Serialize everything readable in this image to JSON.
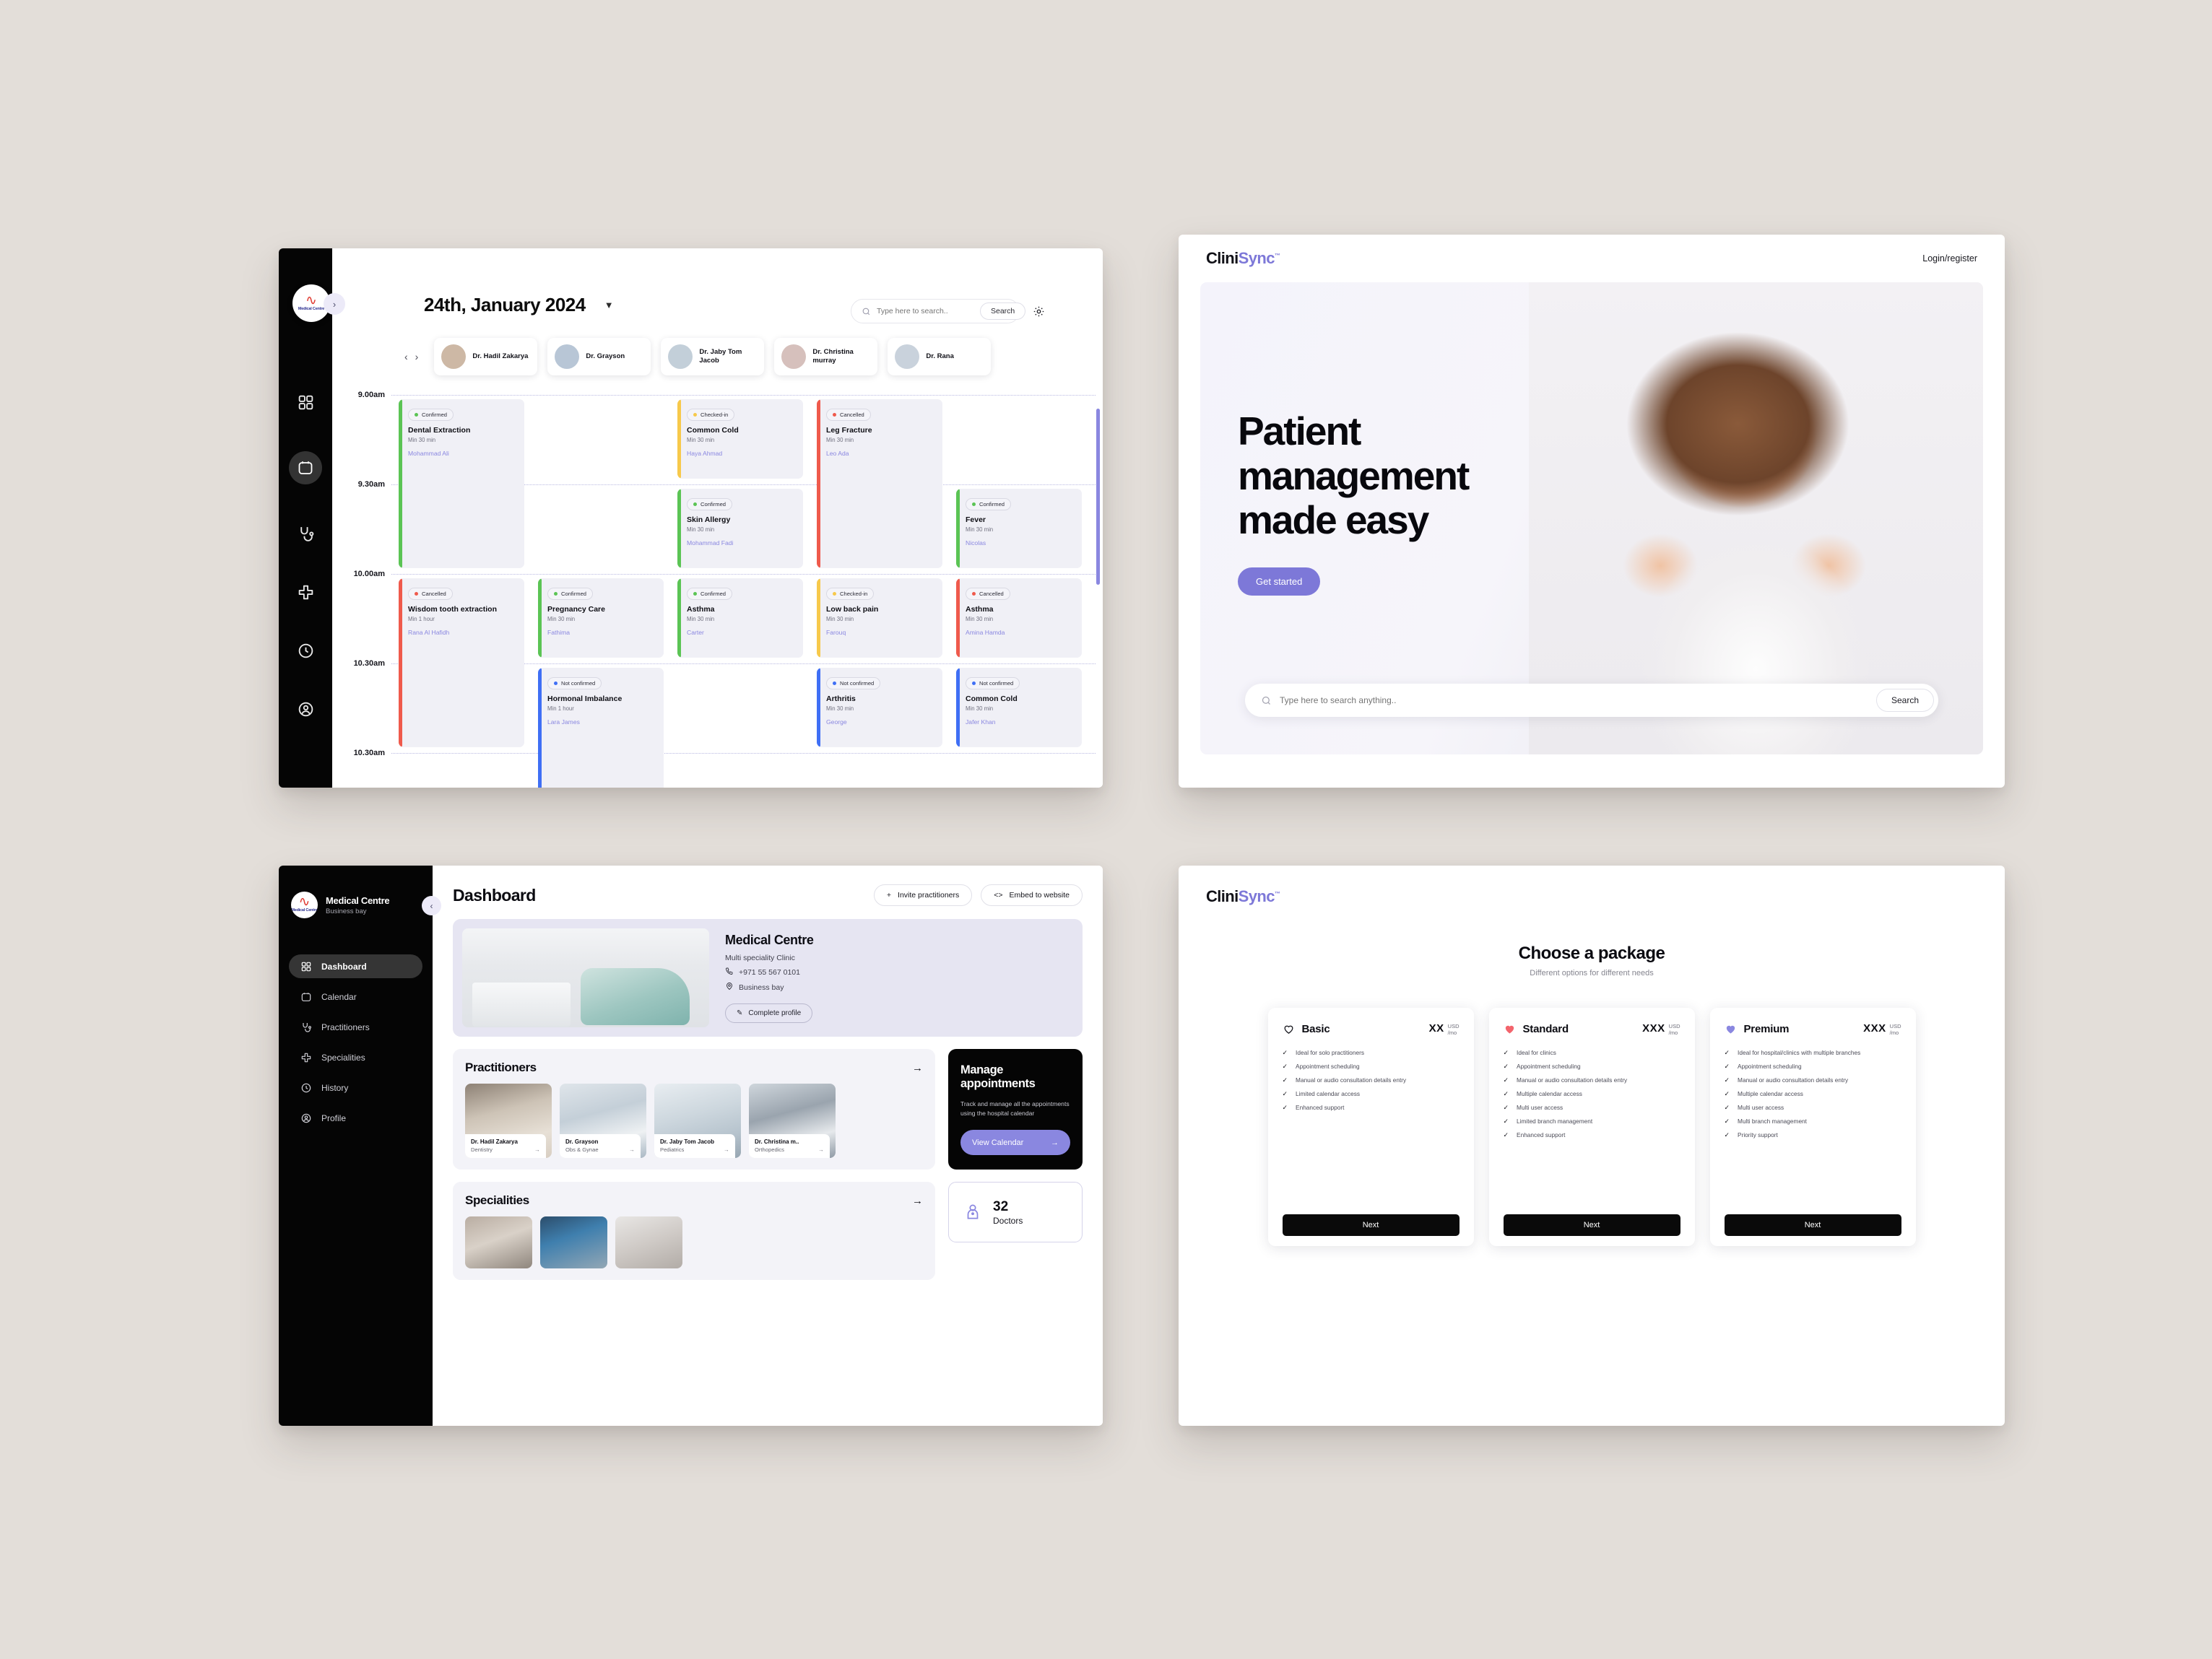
{
  "calendar": {
    "date_label": "24th, January 2024",
    "chevron_icon": "chevron-down-icon",
    "collapse_icon": "chevron-right-icon",
    "logo_text": "Medical Centre",
    "search": {
      "placeholder": "Type here to search..",
      "button_label": "Search"
    },
    "rail_items": [
      "dashboard-icon",
      "calendar-icon",
      "stethoscope-icon",
      "specialities-icon",
      "history-icon",
      "profile-icon"
    ],
    "doctors": [
      {
        "name": "Dr. Hadil Zakarya"
      },
      {
        "name": "Dr. Grayson"
      },
      {
        "name": "Dr. Jaby Tom Jacob"
      },
      {
        "name": "Dr. Christina murray"
      },
      {
        "name": "Dr. Rana"
      }
    ],
    "times": [
      "9.00am",
      "9.30am",
      "10.00am",
      "10.30am",
      "10.30am"
    ],
    "appointments": [
      {
        "status": "Confirmed",
        "color": "#5bc454",
        "title": "Dental Extraction",
        "duration": "Min 30 min",
        "patient": "Mohammad Ali",
        "col": 0,
        "row": 0,
        "span": 2
      },
      {
        "status": "Checked-in",
        "color": "#f7c94b",
        "title": "Common Cold",
        "duration": "Min 30 min",
        "patient": "Haya Ahmad",
        "col": 2,
        "row": 0,
        "span": 1
      },
      {
        "status": "Cancelled",
        "color": "#ef5a4c",
        "title": "Leg Fracture",
        "duration": "Min 30 min",
        "patient": "Leo Ada",
        "col": 3,
        "row": 0,
        "span": 2
      },
      {
        "status": "Confirmed",
        "color": "#5bc454",
        "title": "Skin Allergy",
        "duration": "Min 30 min",
        "patient": "Mohammad Fadi",
        "col": 2,
        "row": 1,
        "span": 1
      },
      {
        "status": "Confirmed",
        "color": "#5bc454",
        "title": "Fever",
        "duration": "Min 30 min",
        "patient": "Nicolas",
        "col": 4,
        "row": 1,
        "span": 1
      },
      {
        "status": "Cancelled",
        "color": "#ef5a4c",
        "title": "Wisdom tooth extraction",
        "duration": "Min 1 hour",
        "patient": "Rana Al Hafidh",
        "col": 0,
        "row": 2,
        "span": 2
      },
      {
        "status": "Confirmed",
        "color": "#5bc454",
        "title": "Pregnancy Care",
        "duration": "Min 30 min",
        "patient": "Fathima",
        "col": 1,
        "row": 2,
        "span": 1
      },
      {
        "status": "Confirmed",
        "color": "#5bc454",
        "title": "Asthma",
        "duration": "Min 30 min",
        "patient": "Carter",
        "col": 2,
        "row": 2,
        "span": 1
      },
      {
        "status": "Checked-in",
        "color": "#f7c94b",
        "title": "Low back pain",
        "duration": "Min 30 min",
        "patient": "Farouq",
        "col": 3,
        "row": 2,
        "span": 1
      },
      {
        "status": "Cancelled",
        "color": "#ef5a4c",
        "title": "Asthma",
        "duration": "Min 30 min",
        "patient": "Amina Hamda",
        "col": 4,
        "row": 2,
        "span": 1
      },
      {
        "status": "Not confirmed",
        "color": "#3f6ff5",
        "title": "Hormonal Imbalance",
        "duration": "Min 1 hour",
        "patient": "Lara James",
        "col": 1,
        "row": 3,
        "span": 2
      },
      {
        "status": "Not confirmed",
        "color": "#3f6ff5",
        "title": "Arthritis",
        "duration": "Min 30 min",
        "patient": "George",
        "col": 3,
        "row": 3,
        "span": 1
      },
      {
        "status": "Not confirmed",
        "color": "#3f6ff5",
        "title": "Common Cold",
        "duration": "Min 30 min",
        "patient": "Jafer Khan",
        "col": 4,
        "row": 3,
        "span": 1
      }
    ]
  },
  "landing": {
    "brand_part1": "Clini",
    "brand_part2": "Sync",
    "brand_tm": "™",
    "login_label": "Login/register",
    "headline_line1": "Patient",
    "headline_line2": "management",
    "headline_line3": "made easy",
    "cta_label": "Get started",
    "search": {
      "placeholder": "Type here to search anything..",
      "button_label": "Search"
    },
    "accent_color": "#7d78d8"
  },
  "dashboard": {
    "clinic_name_side": "Medical Centre",
    "clinic_sub_side": "Business bay",
    "collapse_icon": "chevron-left-icon",
    "nav": [
      {
        "label": "Dashboard",
        "icon": "grid-icon"
      },
      {
        "label": "Calendar",
        "icon": "calendar-icon"
      },
      {
        "label": "Practitioners",
        "icon": "stethoscope-icon"
      },
      {
        "label": "Specialities",
        "icon": "cross-icon"
      },
      {
        "label": "History",
        "icon": "history-icon"
      },
      {
        "label": "Profile",
        "icon": "profile-icon"
      }
    ],
    "title": "Dashboard",
    "invite_label": "Invite practitioners",
    "embed_label": "Embed to website",
    "clinic": {
      "name": "Medical Centre",
      "type": "Multi speciality Clinic",
      "phone": "+971 55 567 0101",
      "location": "Business bay",
      "complete_label": "Complete profile"
    },
    "practitioners_title": "Practitioners",
    "practitioners": [
      {
        "name": "Dr. Hadil Zakarya",
        "speciality": "Dentistry"
      },
      {
        "name": "Dr. Grayson",
        "speciality": "Obs & Gynae"
      },
      {
        "name": "Dr. Jaby Tom Jacob",
        "speciality": "Pediatrics"
      },
      {
        "name": "Dr. Christina m..",
        "speciality": "Orthopedics"
      }
    ],
    "manage": {
      "title_line1": "Manage",
      "title_line2": "appointments",
      "body": "Track and manage all the appointments using the hospital calendar",
      "button_label": "View Calendar"
    },
    "specialities_title": "Specialities",
    "doctors_count": "32",
    "doctors_label": "Doctors"
  },
  "pricing": {
    "brand_part1": "Clini",
    "brand_part2": "Sync",
    "brand_tm": "™",
    "title": "Choose a package",
    "subtitle": "Different options for different needs",
    "next_label": "Next",
    "plans": [
      {
        "name": "Basic",
        "icon": "heart-outline-icon",
        "icon_color": "#15151c",
        "amount": "XX",
        "currency": "USD",
        "period": "/mo",
        "features": [
          "Ideal for solo practitioners",
          "Appointment scheduling",
          "Manual or audio consultation details entry",
          "Limited calendar access",
          "Enhanced support"
        ]
      },
      {
        "name": "Standard",
        "icon": "heart-filled-icon",
        "icon_color": "#f3646c",
        "amount": "XXX",
        "currency": "USD",
        "period": "/mo",
        "features": [
          "Ideal for clinics",
          "Appointment scheduling",
          "Manual or audio consultation details entry",
          "Multiple calendar access",
          "Multi user access",
          "Limited branch management",
          "Enhanced support"
        ]
      },
      {
        "name": "Premium",
        "icon": "heart-filled-icon",
        "icon_color": "#8a87e0",
        "amount": "XXX",
        "currency": "USD",
        "period": "/mo",
        "features": [
          "Ideal for hospital/clinics with multiple branches",
          "Appointment scheduling",
          "Manual or audio consultation details entry",
          "Multiple calendar access",
          "Multi user access",
          "Multi branch management",
          "Priority support"
        ]
      }
    ]
  }
}
